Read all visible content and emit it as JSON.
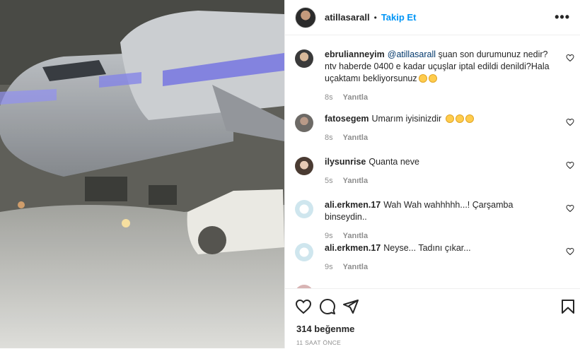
{
  "header": {
    "username": "atillasarall",
    "dot": "•",
    "follow_label": "Takip Et",
    "more_icon": "more-icon"
  },
  "comments": [
    {
      "username": "ebrulianneyim",
      "mention": "@atillasarall",
      "text": " şuan son durumunuz nedir?ntv haberde 0400 e kadar uçuşlar iptal edildi denildi?Hala uçaktamı bekliyorsunuz",
      "emojis": [
        "folded-hands",
        "disappointed"
      ],
      "time": "8s",
      "reply": "Yanıtla"
    },
    {
      "username": "fatosegem",
      "text": "Umarım iyisinizdir",
      "emojis": [
        "frowning",
        "frowning",
        "frowning"
      ],
      "time": "8s",
      "reply": "Yanıtla"
    },
    {
      "username": "ilysunrise",
      "text": "Quanta neve",
      "time": "5s",
      "reply": "Yanıtla"
    },
    {
      "username": "ali.erkmen.17",
      "text": "Wah Wah wahhhhh...! Çarşamba binseydin..",
      "time": "9s",
      "reply": "Yanıtla"
    },
    {
      "username": "ali.erkmen.17",
      "text": "Neyse... Tadını çıkar...",
      "time": "9s",
      "reply": "Yanıtla"
    }
  ],
  "actions": {
    "likes": "314 beğenme",
    "time_ago": "11 SAAT ÖNCE"
  },
  "colors": {
    "accent": "#0095f6",
    "text": "#262626",
    "muted": "#8e8e8e"
  }
}
